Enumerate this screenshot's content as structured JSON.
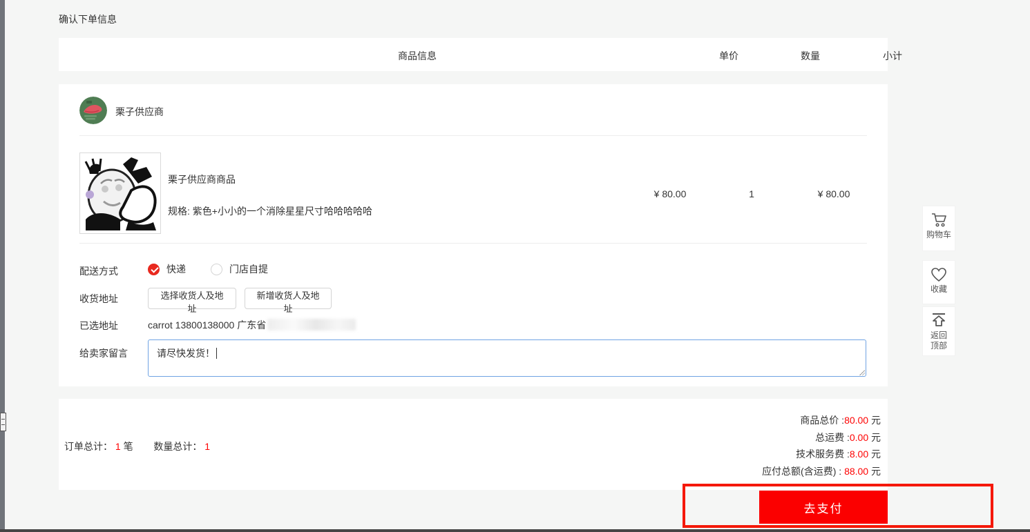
{
  "page": {
    "title": "确认下单信息"
  },
  "table": {
    "headers": {
      "info": "商品信息",
      "unit_price": "单价",
      "quantity": "数量",
      "subtotal": "小计"
    }
  },
  "seller": {
    "name": "栗子供应商"
  },
  "product": {
    "name": "栗子供应商商品",
    "spec": "规格: 紫色+小小的一个消除星星尺寸哈哈哈哈哈",
    "unit_price": "¥ 80.00",
    "quantity": "1",
    "subtotal": "¥ 80.00"
  },
  "form": {
    "delivery_label": "配送方式",
    "delivery_options": [
      {
        "label": "快递",
        "selected": true
      },
      {
        "label": "门店自提",
        "selected": false
      }
    ],
    "address_label": "收货地址",
    "select_address_button": "选择收货人及地址",
    "add_address_button": "新增收货人及地址",
    "selected_address_label": "已选地址",
    "selected_address_value": "carrot 13800138000 广东省",
    "message_label": "给卖家留言",
    "message_value": "请尽快发货！"
  },
  "summary": {
    "order_total_label": "订单总计：",
    "order_total_value": "1",
    "order_total_unit": "笔",
    "quantity_total_label": "数量总计：",
    "quantity_total_value": "1",
    "rows": [
      {
        "label": "商品总价 :",
        "value": "80.00",
        "unit": "元"
      },
      {
        "label": "总运费 :",
        "value": "0.00",
        "unit": "元"
      },
      {
        "label": "技术服务费 :",
        "value": "8.00",
        "unit": "元"
      },
      {
        "label": "应付总额(含运费) : ",
        "value": "88.00",
        "unit": "元"
      }
    ],
    "pay_button": "去支付"
  },
  "sidebar": {
    "items": [
      {
        "icon": "cart-icon",
        "label": "购物车"
      },
      {
        "icon": "heart-icon",
        "label": "收藏"
      },
      {
        "icon": "back-to-top-icon",
        "label": "返回顶部"
      }
    ]
  },
  "colors": {
    "accent_red": "#f51808",
    "button_red": "#fb0000",
    "price_red": "#fe0202",
    "radio_red": "#e8291f",
    "textarea_border": "#6fa3e3"
  }
}
